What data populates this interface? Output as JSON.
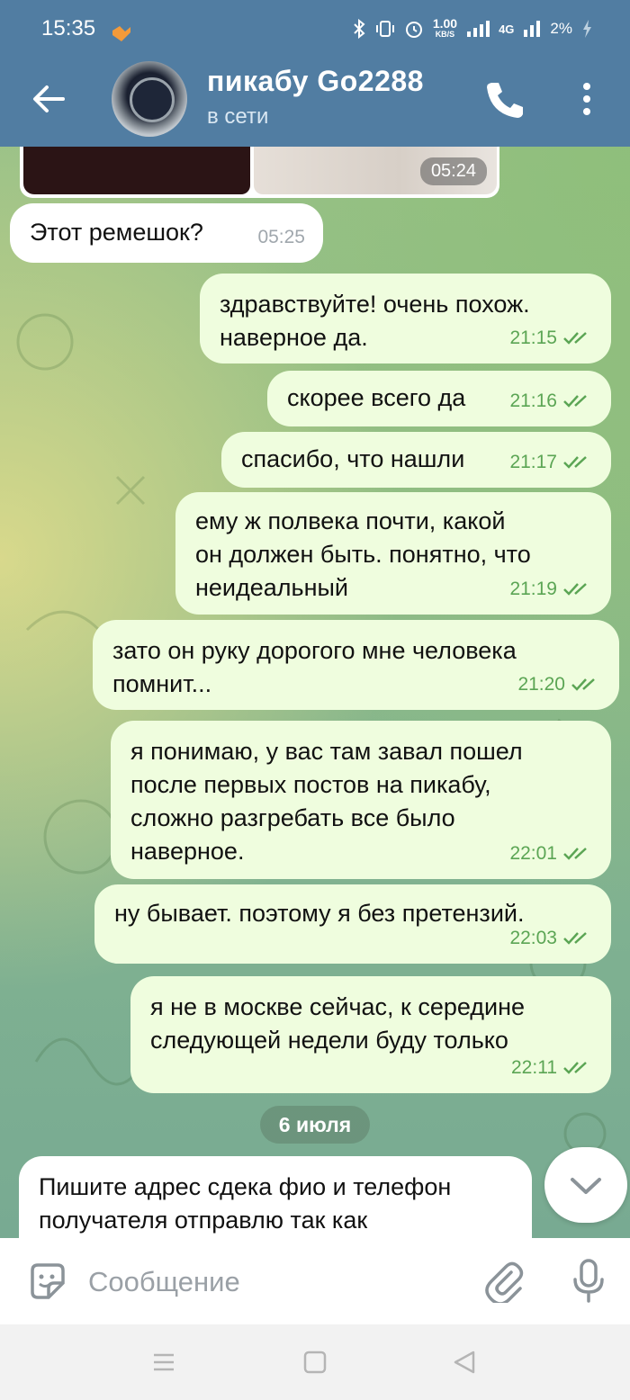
{
  "status_bar": {
    "time": "15:35",
    "net_speed_value": "1.00",
    "net_speed_unit": "KB/S",
    "network": "4G",
    "battery": "2%"
  },
  "header": {
    "title": "пикабу Go2288",
    "subtitle": "в сети"
  },
  "media": {
    "time": "05:24"
  },
  "messages": [
    {
      "dir": "in",
      "text": "Этот ремешок?",
      "time": "05:25"
    },
    {
      "dir": "out",
      "text": "здравствуйте! очень похож.\nнаверное да.",
      "time": "21:15"
    },
    {
      "dir": "out",
      "text": "скорее всего да",
      "time": "21:16"
    },
    {
      "dir": "out",
      "text": "спасибо, что нашли",
      "time": "21:17"
    },
    {
      "dir": "out",
      "text": "ему ж полвека почти, какой\nон должен быть. понятно, что\nнеидеальный",
      "time": "21:19"
    },
    {
      "dir": "out",
      "text": "зато он руку дорогого мне человека\nпомнит...",
      "time": "21:20"
    },
    {
      "dir": "out",
      "text": "я понимаю, у вас там завал пошел\nпосле первых постов на пикабу,\nсложно разгребать все было\nнаверное.",
      "time": "22:01"
    },
    {
      "dir": "out",
      "text": "ну бывает. поэтому я без претензий.",
      "time": "22:03"
    },
    {
      "dir": "out",
      "text": "я не в москве сейчас, к середине\nследующей недели буду только",
      "time": "22:11"
    },
    {
      "dir": "in",
      "text": "Пишите адрес сдека фио и телефон\nполучателя отправлю так как",
      "time": ""
    }
  ],
  "date_divider": "6 июля",
  "composer": {
    "placeholder": "Сообщение"
  },
  "colors": {
    "header": "#517da2",
    "outgoing_bubble": "#effdde",
    "incoming_bubble": "#ffffff",
    "check_marks": "#5ba554"
  },
  "icons": {
    "back": "arrow-left-icon",
    "call": "phone-icon",
    "more": "dots-vertical-icon",
    "sticker": "sticker-icon",
    "attach": "paperclip-icon",
    "mic": "microphone-icon",
    "scroll": "chevron-down-icon"
  }
}
